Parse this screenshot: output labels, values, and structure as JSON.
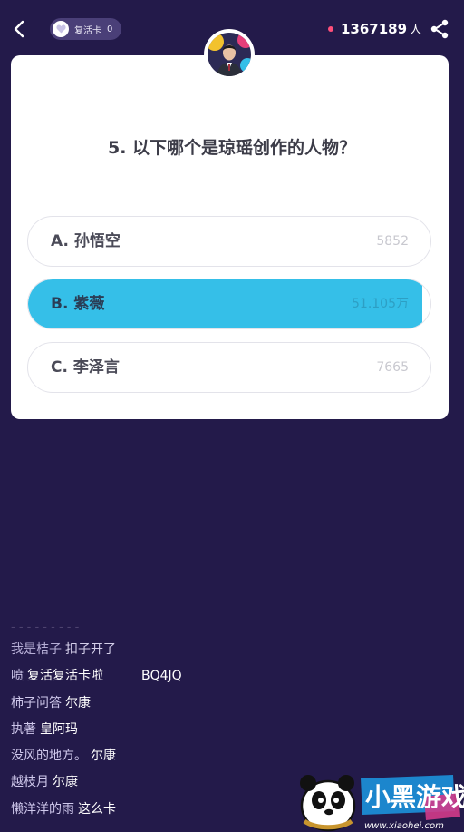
{
  "header": {
    "revive_label": "复活卡",
    "revive_count": "0",
    "online_count": "1367189",
    "online_unit": "人"
  },
  "question": {
    "text": "5. 以下哪个是琼瑶创作的人物？",
    "options": [
      {
        "label": "A. 孙悟空",
        "count": "5852",
        "share": 0.01
      },
      {
        "label": "B. 紫薇",
        "count": "51.105万",
        "share": 0.98,
        "selected": true
      },
      {
        "label": "C. 李泽言",
        "count": "7665",
        "share": 0.01
      }
    ]
  },
  "chat": {
    "faded_text": "- - - - - - - - -",
    "messages": [
      {
        "user": "我是桔子",
        "text": "扣子开了"
      },
      {
        "user": "喷",
        "text": "复活复活卡啦　　　BQ4JQ"
      },
      {
        "user": "柿子问答",
        "text": "尔康"
      },
      {
        "user": "执著",
        "text": "皇阿玛"
      },
      {
        "user": "没风的地方。",
        "text": "尔康"
      },
      {
        "user": "越枝月",
        "text": "尔康"
      },
      {
        "user": "懒洋洋的雨",
        "text": "这么卡"
      }
    ]
  },
  "watermark": {
    "brand": "小黑游戏",
    "url": "www.xiaohei.com"
  },
  "colors": {
    "background": "#231a4a",
    "accent": "#35bfe8",
    "card": "#ffffff",
    "online_dot": "#ff4f7a"
  },
  "icons": [
    "back-arrow-icon",
    "heart-icon",
    "share-icon"
  ]
}
